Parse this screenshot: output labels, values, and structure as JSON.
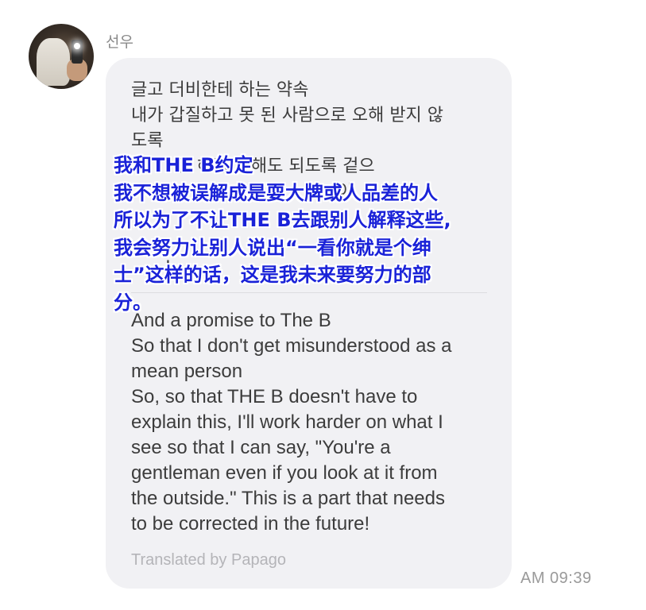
{
  "message": {
    "sender_name": "선우",
    "avatar_icon": "user-avatar-photo",
    "original_lines": [
      "글고 더비한테 하는 약속",
      "내가 갑질하고 못 된 사람으로 오해 받지 않",
      "도록",
      "        런 해명 안해도 되도록 겉으",
      "                                     이",
      "                                      ",
      "                                      ",
      "      !"
    ],
    "overlay_lines": [
      "我和THE B约定",
      "我不想被误解成是耍大牌或人品差的人",
      "所以为了不让THE B去跟别人解释这些,",
      "我会努力让别人说出“一看你就是个绅",
      "士”这样的话，这是我未来要努力的部",
      "分。"
    ],
    "translated_lines": [
      "And a promise to The B",
      "So that I don't get misunderstood as a",
      "mean person",
      "So, so that THE B doesn't have to",
      "explain this, I'll work harder on what I",
      "see so that I can say, \"You're a",
      "gentleman even if you look at it from",
      "the outside.\" This is a part that needs",
      "to be corrected in the future!"
    ],
    "translation_credit": "Translated by Papago",
    "timestamp": "AM 09:39"
  },
  "colors": {
    "bubble_bg": "#f1f1f4",
    "overlay_text": "#1a22d8",
    "body_text": "#3c3c3c",
    "muted_text": "#9a9a9a"
  }
}
